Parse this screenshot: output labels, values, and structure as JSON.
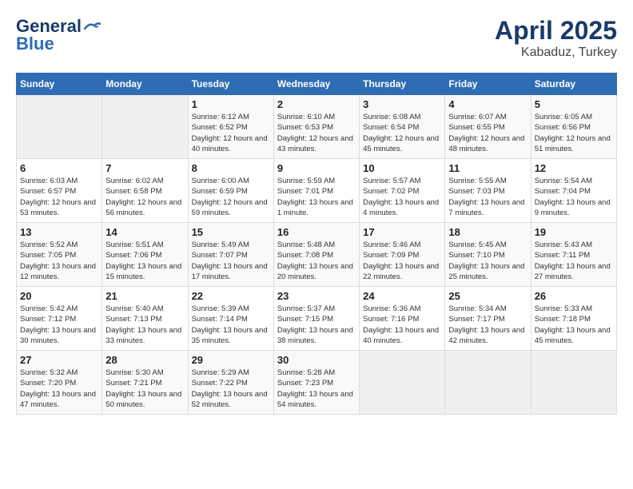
{
  "header": {
    "logo_line1": "General",
    "logo_line2": "Blue",
    "title": "April 2025",
    "subtitle": "Kabaduz, Turkey"
  },
  "days_of_week": [
    "Sunday",
    "Monday",
    "Tuesday",
    "Wednesday",
    "Thursday",
    "Friday",
    "Saturday"
  ],
  "weeks": [
    [
      {
        "day": "",
        "empty": true
      },
      {
        "day": "",
        "empty": true
      },
      {
        "day": "1",
        "sunrise": "6:12 AM",
        "sunset": "6:52 PM",
        "daylight": "12 hours and 40 minutes."
      },
      {
        "day": "2",
        "sunrise": "6:10 AM",
        "sunset": "6:53 PM",
        "daylight": "12 hours and 43 minutes."
      },
      {
        "day": "3",
        "sunrise": "6:08 AM",
        "sunset": "6:54 PM",
        "daylight": "12 hours and 45 minutes."
      },
      {
        "day": "4",
        "sunrise": "6:07 AM",
        "sunset": "6:55 PM",
        "daylight": "12 hours and 48 minutes."
      },
      {
        "day": "5",
        "sunrise": "6:05 AM",
        "sunset": "6:56 PM",
        "daylight": "12 hours and 51 minutes."
      }
    ],
    [
      {
        "day": "6",
        "sunrise": "6:03 AM",
        "sunset": "6:57 PM",
        "daylight": "12 hours and 53 minutes."
      },
      {
        "day": "7",
        "sunrise": "6:02 AM",
        "sunset": "6:58 PM",
        "daylight": "12 hours and 56 minutes."
      },
      {
        "day": "8",
        "sunrise": "6:00 AM",
        "sunset": "6:59 PM",
        "daylight": "12 hours and 59 minutes."
      },
      {
        "day": "9",
        "sunrise": "5:59 AM",
        "sunset": "7:01 PM",
        "daylight": "13 hours and 1 minute."
      },
      {
        "day": "10",
        "sunrise": "5:57 AM",
        "sunset": "7:02 PM",
        "daylight": "13 hours and 4 minutes."
      },
      {
        "day": "11",
        "sunrise": "5:55 AM",
        "sunset": "7:03 PM",
        "daylight": "13 hours and 7 minutes."
      },
      {
        "day": "12",
        "sunrise": "5:54 AM",
        "sunset": "7:04 PM",
        "daylight": "13 hours and 9 minutes."
      }
    ],
    [
      {
        "day": "13",
        "sunrise": "5:52 AM",
        "sunset": "7:05 PM",
        "daylight": "13 hours and 12 minutes."
      },
      {
        "day": "14",
        "sunrise": "5:51 AM",
        "sunset": "7:06 PM",
        "daylight": "13 hours and 15 minutes."
      },
      {
        "day": "15",
        "sunrise": "5:49 AM",
        "sunset": "7:07 PM",
        "daylight": "13 hours and 17 minutes."
      },
      {
        "day": "16",
        "sunrise": "5:48 AM",
        "sunset": "7:08 PM",
        "daylight": "13 hours and 20 minutes."
      },
      {
        "day": "17",
        "sunrise": "5:46 AM",
        "sunset": "7:09 PM",
        "daylight": "13 hours and 22 minutes."
      },
      {
        "day": "18",
        "sunrise": "5:45 AM",
        "sunset": "7:10 PM",
        "daylight": "13 hours and 25 minutes."
      },
      {
        "day": "19",
        "sunrise": "5:43 AM",
        "sunset": "7:11 PM",
        "daylight": "13 hours and 27 minutes."
      }
    ],
    [
      {
        "day": "20",
        "sunrise": "5:42 AM",
        "sunset": "7:12 PM",
        "daylight": "13 hours and 30 minutes."
      },
      {
        "day": "21",
        "sunrise": "5:40 AM",
        "sunset": "7:13 PM",
        "daylight": "13 hours and 33 minutes."
      },
      {
        "day": "22",
        "sunrise": "5:39 AM",
        "sunset": "7:14 PM",
        "daylight": "13 hours and 35 minutes."
      },
      {
        "day": "23",
        "sunrise": "5:37 AM",
        "sunset": "7:15 PM",
        "daylight": "13 hours and 38 minutes."
      },
      {
        "day": "24",
        "sunrise": "5:36 AM",
        "sunset": "7:16 PM",
        "daylight": "13 hours and 40 minutes."
      },
      {
        "day": "25",
        "sunrise": "5:34 AM",
        "sunset": "7:17 PM",
        "daylight": "13 hours and 42 minutes."
      },
      {
        "day": "26",
        "sunrise": "5:33 AM",
        "sunset": "7:18 PM",
        "daylight": "13 hours and 45 minutes."
      }
    ],
    [
      {
        "day": "27",
        "sunrise": "5:32 AM",
        "sunset": "7:20 PM",
        "daylight": "13 hours and 47 minutes."
      },
      {
        "day": "28",
        "sunrise": "5:30 AM",
        "sunset": "7:21 PM",
        "daylight": "13 hours and 50 minutes."
      },
      {
        "day": "29",
        "sunrise": "5:29 AM",
        "sunset": "7:22 PM",
        "daylight": "13 hours and 52 minutes."
      },
      {
        "day": "30",
        "sunrise": "5:28 AM",
        "sunset": "7:23 PM",
        "daylight": "13 hours and 54 minutes."
      },
      {
        "day": "",
        "empty": true
      },
      {
        "day": "",
        "empty": true
      },
      {
        "day": "",
        "empty": true
      }
    ]
  ]
}
